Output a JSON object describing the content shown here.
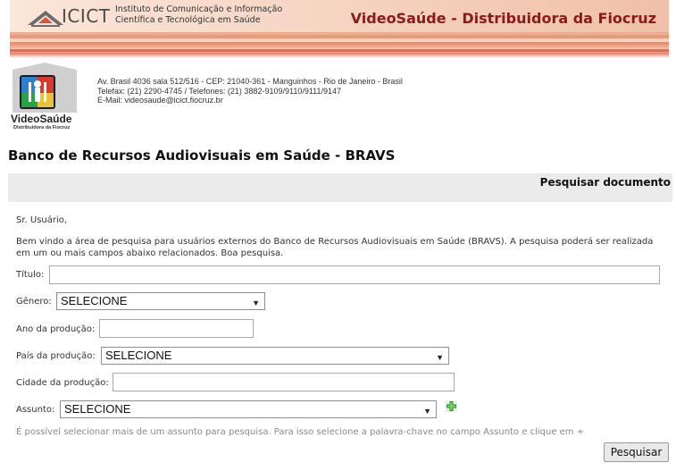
{
  "header": {
    "icict_logo_text": "ICICT",
    "institution_line1": "Instituto de Comunicação e Informação",
    "institution_line2": "Científica e Tecnológica em Saúde",
    "title": "VideoSaúde - Distribuidora da Fiocruz"
  },
  "logo": {
    "name": "VideoSaúde",
    "subtitle": "Distribuidora da Fiocruz"
  },
  "address": {
    "line1": "Av. Brasil 4036 sala 512/516 - CEP: 21040-361 - Manguinhos - Rio de Janeiro - Brasil",
    "line2": "Telefax: (21) 2290-4745 / Telefones: (21) 3882-9109/9110/9111/9147",
    "line3": "E-Mail: videosaude@icict.fiocruz.br"
  },
  "page_title": "Banco de Recursos Audiovisuais em Saúde - BRAVS",
  "section_title": "Pesquisar documento",
  "greeting": "Sr. Usuário,",
  "welcome_text": "Bem vindo a área de pesquisa para usuários externos do Banco de Recursos Audiovisuais em Saúde (BRAVS). A pesquisa poderá ser realizada em um ou mais campos abaixo relacionados. Boa pesquisa.",
  "form": {
    "titulo_label": "Título:",
    "titulo_value": "",
    "genero_label": "Gênero:",
    "genero_value": "SELECIONE",
    "ano_label": "Ano da produção:",
    "ano_value": "",
    "pais_label": "País da produção:",
    "pais_value": "SELECIONE",
    "cidade_label": "Cidade da produção:",
    "cidade_value": "",
    "assunto_label": "Assunto:",
    "assunto_value": "SELECIONE",
    "hint": "É possível selecionar mais de um assunto para pesquisa. Para isso selecione a palavra-chave no campo Assunto e clique em +",
    "submit_label": "Pesquisar"
  },
  "colors": {
    "banner_title": "#8b1a1a",
    "search_bar_bg": "#ebebeb",
    "hint_text": "#8a8a8a"
  }
}
